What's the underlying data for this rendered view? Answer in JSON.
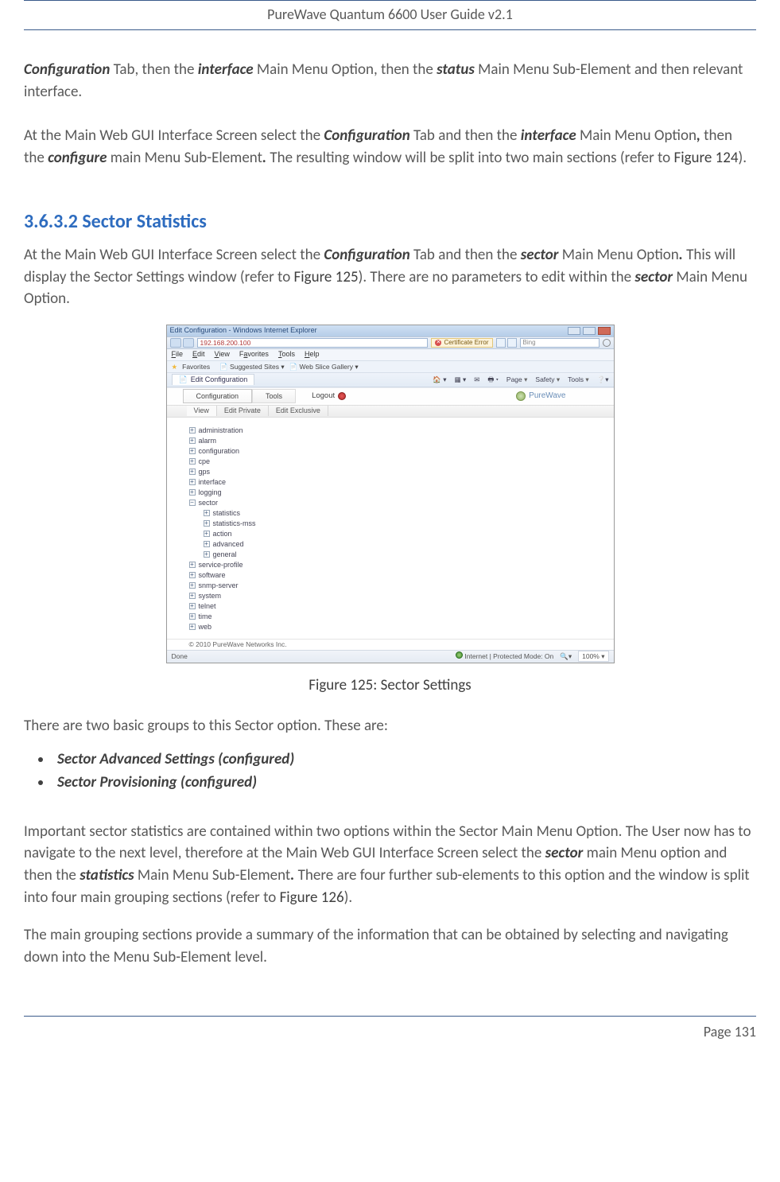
{
  "header": {
    "title": "PureWave Quantum 6600 User Guide v2.1"
  },
  "footer": {
    "page_label": "Page 131"
  },
  "body": {
    "p1": {
      "s1a": "Configuration",
      "s1b": " Tab, then the ",
      "s1c": "interface",
      "s1d": " Main Menu Option, then the ",
      "s1e": "status",
      "s1f": " Main Menu Sub-Element and then relevant interface."
    },
    "p2": {
      "a": "At the Main Web GUI Interface Screen select the ",
      "b": "Configuration",
      "c": " Tab and then the ",
      "d": "interface",
      "e": " Main Menu Option",
      "f": ",",
      "g": " then the ",
      "h": "configure",
      "i": " main Menu Sub-Element",
      "j": ".",
      "k": " The resulting window will be split into two main sections (refer to ",
      "l": "Figure 124",
      "m": ")."
    },
    "section_heading": "3.6.3.2 Sector Statistics",
    "p3": {
      "a": "At the Main Web GUI Interface Screen select the ",
      "b": "Configuration",
      "c": " Tab and then the ",
      "d": "sector",
      "e": " Main Menu Option",
      "f": ".",
      "g": " This will display the Sector Settings window (refer to ",
      "h": "Figure 125",
      "i": "). There are no parameters to edit within the ",
      "j": "sector",
      "k": " Main Menu Option."
    },
    "caption_125": "Figure 125: Sector Settings",
    "p4": "There are two basic groups to this Sector option. These are:",
    "list": {
      "item1": "Sector Advanced Settings (configured)",
      "item2": "Sector Provisioning (configured)"
    },
    "p5": {
      "a": "Important sector statistics are contained within two options within the Sector Main Menu Option. The User now has to navigate to the next level, therefore at the Main Web GUI Interface Screen select the ",
      "b": "sector",
      "c": " main Menu option and then the ",
      "d": "statistics",
      "e": " Main Menu Sub-Element",
      "f": ".",
      "g": " There are four further sub-elements to this option and the window is split into four main grouping sections (refer to ",
      "h": "Figure 126",
      "i": ")."
    },
    "p6": "The main grouping sections provide a summary of the information that can be obtained by selecting and navigating down into the Menu Sub-Element level."
  },
  "shot": {
    "window_title": "Edit Configuration - Windows Internet Explorer",
    "url_ip": "192.168.200.100",
    "cert_error": "Certificate Error",
    "search_hint": "Bing",
    "menubar": {
      "file": "File",
      "edit": "Edit",
      "view": "View",
      "favorites": "Favorites",
      "tools": "Tools",
      "help": "Help"
    },
    "favbar": {
      "label": "Favorites",
      "suggested": "Suggested Sites",
      "slice": "Web Slice Gallery"
    },
    "pagetab_title": "Edit Configuration",
    "ie_tools": {
      "page": "Page",
      "safety": "Safety",
      "tools": "Tools"
    },
    "app_tabs": {
      "configuration": "Configuration",
      "tools": "Tools",
      "logout": "Logout"
    },
    "brand": "PureWave",
    "view_tabs": {
      "view": "View",
      "edit_private": "Edit Private",
      "edit_exclusive": "Edit Exclusive"
    },
    "tree": {
      "administration": "administration",
      "alarm": "alarm",
      "configuration": "configuration",
      "cpe": "cpe",
      "gps": "gps",
      "interface": "interface",
      "logging": "logging",
      "sector": "sector",
      "statistics": "statistics",
      "statistics_mss": "statistics-mss",
      "action": "action",
      "advanced": "advanced",
      "general": "general",
      "service_profile": "service-profile",
      "software": "software",
      "snmp_server": "snmp-server",
      "system": "system",
      "telnet": "telnet",
      "time": "time",
      "web": "web"
    },
    "copyright": "© 2010 PureWave Networks Inc.",
    "statusbar": {
      "left": "Done",
      "protected": "Internet | Protected Mode: On",
      "zoom": "100%"
    }
  }
}
